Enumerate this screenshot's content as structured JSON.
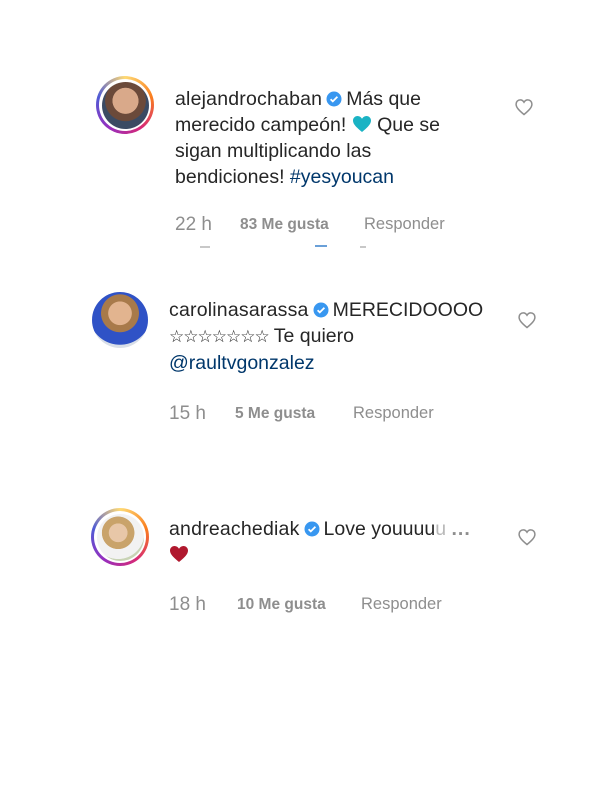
{
  "colors": {
    "text": "#262626",
    "secondary": "#8e8e8e",
    "link": "#00376b",
    "verified": "#3897f0",
    "teal_heart": "#1ab3c4",
    "red_heart": "#b0182e"
  },
  "comments": [
    {
      "username": "alejandrochaban",
      "verified": true,
      "text_parts": [
        "Más que",
        "merecido campeón!",
        "Que se",
        "sigan multiplicando las",
        "bendiciones!"
      ],
      "emoji": "teal-heart",
      "hashtag": "#yesyoucan",
      "time": "22 h",
      "likes": "83 Me gusta",
      "reply": "Responder"
    },
    {
      "username": "carolinasarassa",
      "verified": true,
      "text_parts": [
        "MERECIDOOOO",
        "☆☆☆☆☆☆☆",
        "Te quiero"
      ],
      "mention": "@raultvgonzalez",
      "time": "15 h",
      "likes": "5 Me gusta",
      "reply": "Responder"
    },
    {
      "username": "andreachediak",
      "verified": true,
      "text_parts": [
        "Love youuuu",
        "u"
      ],
      "more": "...",
      "emoji": "red-heart",
      "time": "18 h",
      "likes": "10 Me gusta",
      "reply": "Responder"
    }
  ],
  "icons": {
    "like": "heart-outline-icon",
    "verified": "verified-badge-icon"
  }
}
